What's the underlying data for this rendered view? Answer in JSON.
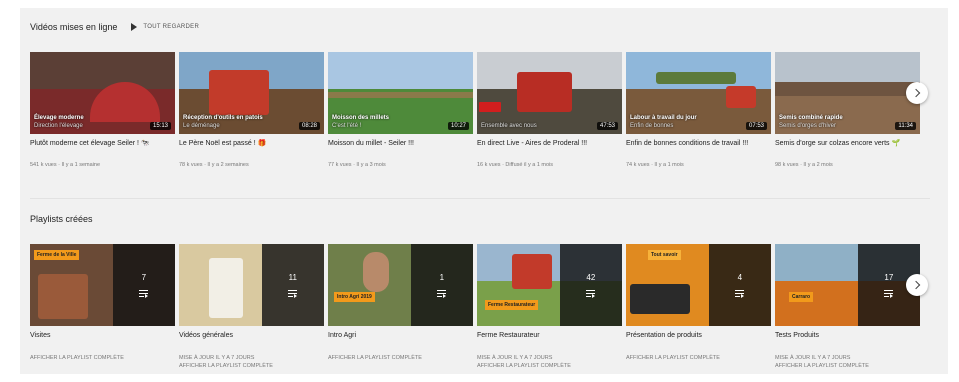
{
  "videos_section": {
    "title": "Vidéos mises en ligne",
    "play_all": "TOUT REGARDER",
    "items": [
      {
        "title": "Plutôt moderne cet élevage Seiler ! 🐄",
        "meta": "541 k vues · Il y a 1 semaine",
        "duration": "15:13",
        "cap": "Élevage moderne",
        "cap_sub": "Direction l'élevage"
      },
      {
        "title": "Le Père Noël est passé ! 🎁",
        "meta": "78 k vues · Il y a 2 semaines",
        "duration": "08:28",
        "cap": "Réception d'outils en patois",
        "cap_sub": "Le déménage"
      },
      {
        "title": "Moisson du millet - Seiler !!!",
        "meta": "77 k vues · Il y a 3 mois",
        "duration": "10:27",
        "cap": "Moisson des millets",
        "cap_sub": "C'est l'été !"
      },
      {
        "title": "En direct Live - Aires de Proderal !!!",
        "meta": "16 k vues · Diffusé il y a 1 mois",
        "duration": "47:53",
        "cap": "",
        "cap_sub": "Ensemble avec nous"
      },
      {
        "title": "Enfin de bonnes conditions de travail !!!",
        "meta": "74 k vues · Il y a 1 mois",
        "duration": "07:53",
        "cap": "Labour à travail du jour",
        "cap_sub": "Enfin de bonnes"
      },
      {
        "title": "Semis d'orge sur colzas encore verts 🌱",
        "meta": "98 k vues · Il y a 2 mois",
        "duration": "11:34",
        "cap": "Semis combiné rapide",
        "cap_sub": "Semis d'orges d'hiver"
      }
    ]
  },
  "playlists_section": {
    "title": "Playlists créées",
    "items": [
      {
        "title": "Visites",
        "count": "7",
        "meta1": "Afficher la playlist complète",
        "meta2": "",
        "tag": "Ferme de la Ville"
      },
      {
        "title": "Vidéos générales",
        "count": "11",
        "meta1": "Mise à jour il y a 7 jours",
        "meta2": "Afficher la playlist complète",
        "tag": ""
      },
      {
        "title": "Intro Agri",
        "count": "1",
        "meta1": "Afficher la playlist complète",
        "meta2": "",
        "tag": "Intro Agri 2019"
      },
      {
        "title": "Ferme Restaurateur",
        "count": "42",
        "meta1": "Mise à jour il y a 7 jours",
        "meta2": "Afficher la playlist complète",
        "tag": "Ferme Restaurateur"
      },
      {
        "title": "Présentation de produits",
        "count": "4",
        "meta1": "Afficher la playlist complète",
        "meta2": "",
        "tag": "Tout savoir"
      },
      {
        "title": "Tests Produits",
        "count": "17",
        "meta1": "Mise à jour il y a 7 jours",
        "meta2": "Afficher la playlist complète",
        "tag": "Carraro"
      }
    ]
  },
  "colors": {
    "background": "#f1f1f1",
    "accent": "#f29a1b"
  },
  "icons": {
    "play_all": "play-icon",
    "next": "chevron-right-icon",
    "playlist": "playlist-icon"
  }
}
